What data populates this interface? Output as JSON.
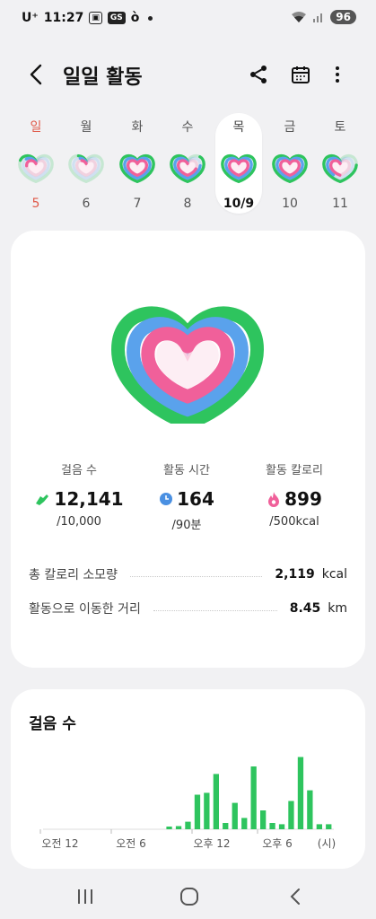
{
  "status_bar": {
    "carrier": "U⁺",
    "time": "11:27",
    "chip1": "▣",
    "chip2": "GS",
    "chip3": "ò",
    "battery": "96"
  },
  "app_bar": {
    "title": "일일 활동",
    "icons": [
      "back-arrow-icon",
      "share-icon",
      "calendar-icon",
      "more-vert-icon"
    ]
  },
  "week": [
    {
      "day": "일",
      "date": "5",
      "move": 0.2,
      "time": 0.15,
      "cal": 0.25,
      "selected": false,
      "sunday": true
    },
    {
      "day": "월",
      "date": "6",
      "move": 0.1,
      "time": 0.1,
      "cal": 0.1,
      "selected": false,
      "sunday": false
    },
    {
      "day": "화",
      "date": "7",
      "move": 1.0,
      "time": 1.0,
      "cal": 1.0,
      "selected": false,
      "sunday": false
    },
    {
      "day": "수",
      "date": "8",
      "move": 0.85,
      "time": 0.75,
      "cal": 0.7,
      "selected": false,
      "sunday": false
    },
    {
      "day": "목",
      "date": "10/9",
      "move": 1.0,
      "time": 1.0,
      "cal": 1.0,
      "selected": true,
      "sunday": false
    },
    {
      "day": "금",
      "date": "10",
      "move": 1.0,
      "time": 1.0,
      "cal": 1.0,
      "selected": false,
      "sunday": false
    },
    {
      "day": "토",
      "date": "11",
      "move": 0.75,
      "time": 0.4,
      "cal": 0.5,
      "selected": false,
      "sunday": false
    }
  ],
  "metrics": {
    "steps": {
      "label": "걸음 수",
      "value": "12,141",
      "goal": "/10,000",
      "icon": "shoe-icon",
      "color": "#2ec45e"
    },
    "active": {
      "label": "활동 시간",
      "value": "164",
      "goal": "/90분",
      "icon": "clock-icon",
      "color": "#4a90e2"
    },
    "calories": {
      "label": "활동 칼로리",
      "value": "899",
      "goal": "/500kcal",
      "icon": "flame-icon",
      "color": "#f0609a"
    }
  },
  "summary": {
    "total_calories": {
      "label": "총 칼로리 소모량",
      "value": "2,119",
      "unit": "kcal"
    },
    "distance": {
      "label": "활동으로 이동한 거리",
      "value": "8.45",
      "unit": "km"
    }
  },
  "colors": {
    "move": "#2ec45e",
    "time": "#5aa2ec",
    "calorie": "#f0609a",
    "heart_fill": "#fdeef4"
  },
  "steps_chart": {
    "title": "걸음 수",
    "x_labels": [
      "오전 12",
      "오전 6",
      "오후 12",
      "오후 6",
      "(시)"
    ],
    "bars": [
      0,
      0,
      0,
      0,
      0,
      0,
      0,
      0,
      0,
      0,
      0,
      0,
      0,
      0.04,
      0.05,
      0.12,
      0.55,
      0.58,
      0.88,
      0.1,
      0.42,
      0.18,
      1.0,
      0.3,
      0.1,
      0.08,
      0.45,
      1.15,
      0.62,
      0.08,
      0.08
    ]
  },
  "nav_bar": {
    "icons": [
      "recents-icon",
      "home-icon",
      "back-icon"
    ]
  }
}
